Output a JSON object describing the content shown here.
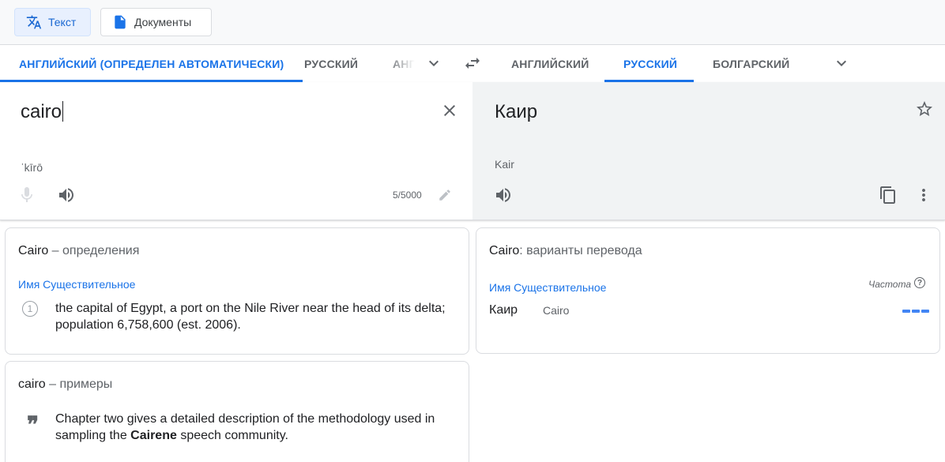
{
  "modes": {
    "text_label": "Текст",
    "docs_label": "Документы"
  },
  "source_langs": {
    "detected": "АНГЛИЙСКИЙ (ОПРЕДЕЛЕН АВТОМАТИЧЕСКИ)",
    "lang2": "РУССКИЙ",
    "lang3": "АНГ"
  },
  "target_langs": {
    "lang1": "АНГЛИЙСКИЙ",
    "lang2": "РУССКИЙ",
    "lang3": "БОЛГАРСКИЙ"
  },
  "source": {
    "text": "cairo",
    "transliteration": "ˈkīrō",
    "char_count": "5/5000"
  },
  "target": {
    "text": "Каир",
    "transliteration": "Kair"
  },
  "definitions": {
    "word": "Cairo",
    "suffix": " – определения",
    "pos": "Имя Существительное",
    "items": [
      {
        "num": "1",
        "text": "the capital of Egypt, a port on the Nile River near the head of its delta; population 6,758,600 (est. 2006)."
      }
    ]
  },
  "translations": {
    "word": "Cairo",
    "suffix": ": варианты перевода",
    "pos": "Имя Существительное",
    "frequency_label": "Частота",
    "help_glyph": "?",
    "rows": [
      {
        "translation": "Каир",
        "back": "Cairo",
        "frequency": 3
      }
    ]
  },
  "examples": {
    "word": "cairo",
    "suffix": " – примеры",
    "quote_glyph": "❞",
    "items": [
      {
        "before": "Chapter two gives a detailed description of the methodology used in sampling the ",
        "bold": "Cairene",
        "after": " speech community."
      }
    ]
  },
  "colors": {
    "accent": "#1a73e8",
    "frequency_bar": "#4285f4",
    "target_bg": "#f1f3f4"
  }
}
